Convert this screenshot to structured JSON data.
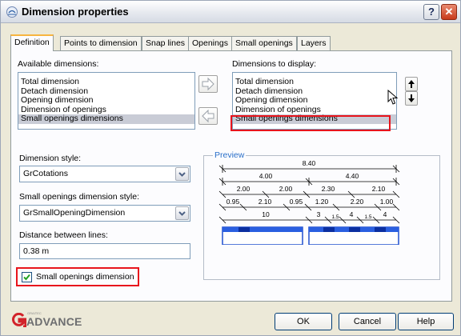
{
  "window": {
    "title": "Dimension properties",
    "help_label": "?",
    "close_label": "✕"
  },
  "tabs": [
    {
      "label": "Definition",
      "active": true
    },
    {
      "label": "Points to dimension"
    },
    {
      "label": "Snap lines"
    },
    {
      "label": "Openings"
    },
    {
      "label": "Small openings"
    },
    {
      "label": "Layers"
    }
  ],
  "available": {
    "label": "Available dimensions:",
    "items": [
      "Total dimension",
      "Detach dimension",
      "Opening dimension",
      "Dimension of openings",
      "Small openings dimensions"
    ],
    "selected_index": 4
  },
  "display": {
    "label": "Dimensions to display:",
    "items": [
      "Total dimension",
      "Detach dimension",
      "Opening dimension",
      "Dimension of openings",
      "Small openings dimensions"
    ],
    "selected_index": 4
  },
  "dimension_style": {
    "label": "Dimension style:",
    "value": "GrCotations"
  },
  "small_style": {
    "label": "Small openings dimension style:",
    "value": "GrSmallOpeningDimension"
  },
  "distance": {
    "label": "Distance between lines:",
    "value": "0.38 m"
  },
  "checkbox": {
    "label": "Small openings dimension",
    "checked": true
  },
  "preview": {
    "label": "Preview",
    "rows": [
      [
        "8.40"
      ],
      [
        "4.00",
        "4.40"
      ],
      [
        "2.00",
        "2.00",
        "2.30",
        "2.10"
      ],
      [
        "0.95",
        "2.10",
        "0.95",
        "1.20",
        "2.20",
        "1.00"
      ],
      [
        "10",
        "3",
        "1.5",
        "4",
        "1.5",
        "4"
      ]
    ]
  },
  "logo": {
    "brand": "ADVANCE",
    "small": "GRAITEC"
  },
  "footer": {
    "ok": "OK",
    "cancel": "Cancel",
    "help": "Help"
  },
  "colors": {
    "highlight": "#e8141c",
    "accent": "#2a6fc9",
    "logo_red": "#d2232a"
  }
}
